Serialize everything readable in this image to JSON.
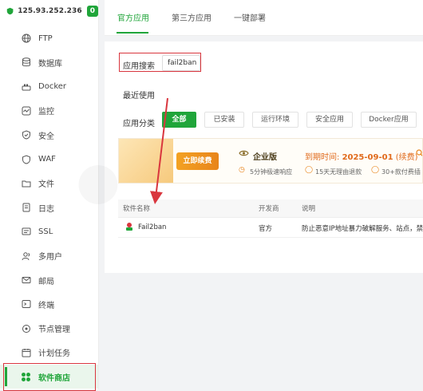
{
  "server": {
    "ip": "125.93.252.236",
    "badge": "0"
  },
  "sidebar": {
    "items": [
      {
        "label": "FTP",
        "icon": "globe-icon"
      },
      {
        "label": "数据库",
        "icon": "database-icon"
      },
      {
        "label": "Docker",
        "icon": "docker-icon"
      },
      {
        "label": "监控",
        "icon": "monitor-icon"
      },
      {
        "label": "安全",
        "icon": "shield-icon"
      },
      {
        "label": "WAF",
        "icon": "waf-shield-icon"
      },
      {
        "label": "文件",
        "icon": "folder-icon"
      },
      {
        "label": "日志",
        "icon": "log-icon"
      },
      {
        "label": "SSL",
        "icon": "ssl-icon"
      },
      {
        "label": "多用户",
        "icon": "users-icon"
      },
      {
        "label": "邮局",
        "icon": "mail-icon"
      },
      {
        "label": "终端",
        "icon": "terminal-icon"
      },
      {
        "label": "节点管理",
        "icon": "node-icon"
      },
      {
        "label": "计划任务",
        "icon": "calendar-icon"
      },
      {
        "label": "软件商店",
        "icon": "store-icon",
        "active": true
      }
    ]
  },
  "tabs": [
    {
      "label": "官方应用",
      "active": true
    },
    {
      "label": "第三方应用"
    },
    {
      "label": "一键部署"
    }
  ],
  "search": {
    "label": "应用搜索",
    "value": "fail2ban"
  },
  "recent": {
    "label": "最近使用"
  },
  "category": {
    "label": "应用分类",
    "buttons": [
      {
        "label": "全部",
        "active": true
      },
      {
        "label": "已安装"
      },
      {
        "label": "运行环境"
      },
      {
        "label": "安全应用"
      },
      {
        "label": "Docker应用"
      }
    ]
  },
  "banner": {
    "buy_label": "立即续费",
    "edition": "企业版",
    "expire_label": "到期时间:",
    "expire_date": "2025-09-01",
    "renew": "(续费)",
    "features": [
      "5分钟极速响应",
      "15天无理由退款",
      "30+款付费插"
    ]
  },
  "table": {
    "headers": [
      "软件名称",
      "开发商",
      "说明"
    ],
    "rows": [
      {
        "name": "Fail2ban",
        "developer": "官方",
        "desc": "防止恶意IP地址暴力破解服务、站点，禁止"
      }
    ]
  },
  "colors": {
    "accent": "#20a53a",
    "highlight": "#d9363e",
    "warning": "#e06a1b"
  }
}
